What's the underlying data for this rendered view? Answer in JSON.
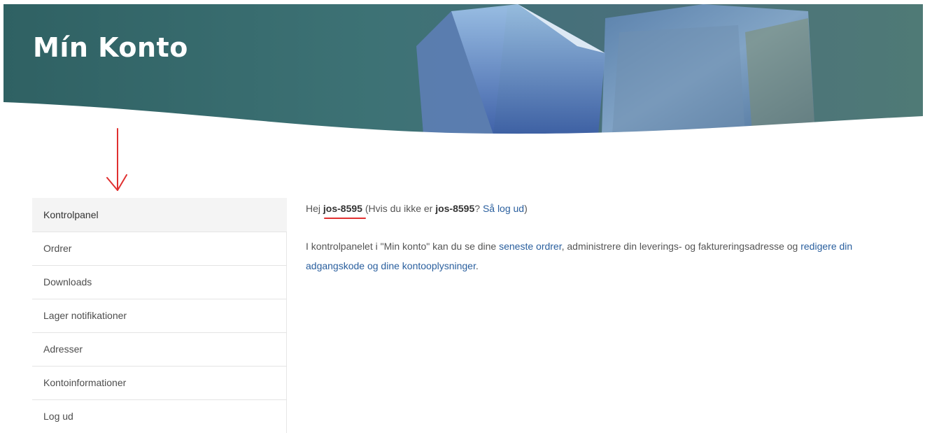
{
  "hero": {
    "title": "Mín Konto"
  },
  "sidebar": {
    "items": [
      {
        "label": "Kontrolpanel",
        "active": true
      },
      {
        "label": "Ordrer",
        "active": false
      },
      {
        "label": "Downloads",
        "active": false
      },
      {
        "label": "Lager notifikationer",
        "active": false
      },
      {
        "label": "Adresser",
        "active": false
      },
      {
        "label": "Kontoinformationer",
        "active": false
      },
      {
        "label": "Log ud",
        "active": false
      }
    ]
  },
  "dashboard": {
    "hello": "Hej",
    "username": "jos-8595",
    "if_not_prefix": "(Hvis du ikke er",
    "username_again": "jos-8595",
    "question": "?",
    "logout_link": "Så log ud",
    "close_paren": ")",
    "desc_part1": "I kontrolpanelet i \"Min konto\" kan du se dine",
    "orders_link": "seneste ordrer",
    "desc_part2": ", administrere din leverings- og faktureringsadresse og",
    "edit_link": "redigere din adgangskode og dine kontooplysninger",
    "desc_end": "."
  },
  "colors": {
    "link": "#2a5f9e",
    "annotation": "#e03030",
    "active_bg": "#f4f4f4"
  }
}
